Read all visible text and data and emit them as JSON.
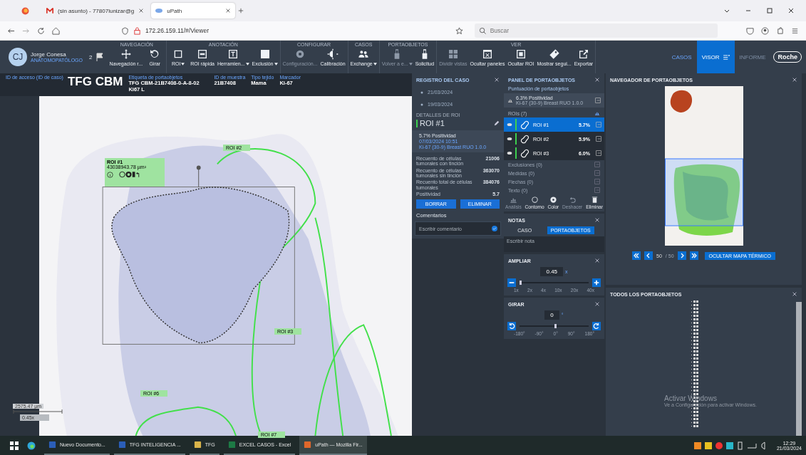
{
  "browser": {
    "tabs": [
      {
        "title": "(sin asunto) - 77807lunizar@g",
        "kind": "mail",
        "selected": false
      },
      {
        "title": "uPath",
        "kind": "app",
        "selected": true
      }
    ],
    "url": "172.26.159.11/#/Viewer",
    "search": {
      "placeholder": "Buscar"
    }
  },
  "user": {
    "initials": "CJ",
    "name": "Jorge Conesa",
    "role": "ANATOMOPATÓLOGO",
    "flag_count": "2"
  },
  "toolbar": {
    "groups": [
      {
        "title": "NAVEGACIÓN",
        "tools": [
          {
            "label": "Navegación r...",
            "kind": "move",
            "disabled": false,
            "dropdown": false
          },
          {
            "label": "Girar",
            "kind": "rotate",
            "disabled": false,
            "dropdown": false
          }
        ]
      },
      {
        "title": "ANOTACIÓN",
        "tools": [
          {
            "label": "ROI",
            "kind": "square",
            "disabled": false,
            "dropdown": true
          },
          {
            "label": "ROI rápida",
            "kind": "roi",
            "disabled": false,
            "dropdown": false
          },
          {
            "label": "Herramien...",
            "kind": "text",
            "disabled": false,
            "dropdown": true
          },
          {
            "label": "Exclusión",
            "kind": "hatch",
            "disabled": false,
            "dropdown": true
          }
        ]
      },
      {
        "title": "CONFIGURAR",
        "tools": [
          {
            "label": "Configuración...",
            "kind": "gear",
            "disabled": true,
            "dropdown": false
          },
          {
            "label": "Calibración",
            "kind": "bright",
            "disabled": false,
            "dropdown": false
          }
        ]
      },
      {
        "title": "CASOS",
        "tools": [
          {
            "label": "Exchange",
            "kind": "people",
            "disabled": false,
            "dropdown": true
          }
        ]
      },
      {
        "title": "PORTAOBJETOS",
        "tools": [
          {
            "label": "Volver a e...",
            "kind": "usb",
            "disabled": true,
            "dropdown": true
          },
          {
            "label": "Solicitud",
            "kind": "usb",
            "disabled": false,
            "dropdown": false
          }
        ]
      },
      {
        "title": "VER",
        "tools": [
          {
            "label": "Dividir vistas",
            "kind": "grid",
            "disabled": true,
            "dropdown": false
          },
          {
            "label": "Ocultar paneles",
            "kind": "xwin",
            "disabled": false,
            "dropdown": false
          },
          {
            "label": "Ocultar ROI",
            "kind": "frame",
            "disabled": false,
            "dropdown": false
          },
          {
            "label": "Mostrar segui...",
            "kind": "tag",
            "disabled": false,
            "dropdown": false
          },
          {
            "label": "Exportar",
            "kind": "export",
            "disabled": false,
            "dropdown": false
          }
        ]
      }
    ]
  },
  "nav_tabs": [
    {
      "label": "CASOS",
      "selected": false,
      "disabled": false
    },
    {
      "label": "VISOR",
      "selected": true,
      "disabled": false
    },
    {
      "label": "INFORME",
      "selected": false,
      "disabled": true
    }
  ],
  "logo": "Roche",
  "case_info": [
    {
      "label": "ID de acceso (ID de caso)",
      "value": "TFG CBM",
      "kind": "big"
    },
    {
      "label": "Etiqueta de portaobjetos",
      "value": "TFG CBM-21B7408-0-A-8-02 Ki67 L",
      "kind": "normal"
    },
    {
      "label": "ID de muestra",
      "value": "21B7408",
      "kind": "normal"
    },
    {
      "label": "Tipo tejido",
      "value": "Mama",
      "kind": "normal"
    },
    {
      "label": "Marcador",
      "value": "Ki-67",
      "kind": "normal"
    }
  ],
  "viewer": {
    "roi_card": {
      "title": "ROI #1",
      "area": "43038943.78 µm²"
    },
    "roi_labels": [
      "ROI #2",
      "ROI #3",
      "ROI #6",
      "ROI #7"
    ],
    "scale": "2575.47 µm",
    "zoom": "0.45x"
  },
  "case_log": {
    "title": "REGISTRO DEL CASO",
    "dates": [
      "21/03/2024",
      "19/03/2024"
    ]
  },
  "roi_details": {
    "heading": "DETALLES DE ROI",
    "name": "ROI #1",
    "positivity": "5.7% Positividad",
    "date": "07/03/2024 10:51",
    "algorithm": "Ki-67 (30-9) Breast RUO 1.0.0",
    "stats": [
      {
        "label": "Recuento de células tumorales con tinción",
        "value": "21006"
      },
      {
        "label": "Recuento de células tumorales sin tinción",
        "value": "363070"
      },
      {
        "label": "Recuento total de células tumorales",
        "value": "384076"
      },
      {
        "label": "Positividad",
        "value": "5.7"
      }
    ],
    "buttons": [
      "BORRAR",
      "ELIMINAR"
    ],
    "comments_title": "Comentarios",
    "comment_placeholder": "Escribir comentario"
  },
  "slide_panel": {
    "title": "PANEL DE PORTAOBJETOS",
    "score_title": "Puntuación de portaobjetos",
    "score": "6.3% Positividad",
    "algorithm": "Ki-67 (30-9) Breast RUO 1.0.0",
    "rois_title": "ROIs (7)",
    "rois": [
      {
        "name": "ROI #1",
        "value": "5.7%",
        "selected": true,
        "color": "#3ccf4e"
      },
      {
        "name": "ROI #2",
        "value": "5.9%",
        "selected": false,
        "color": "#3ccf4e"
      },
      {
        "name": "ROI #3",
        "value": "6.0%",
        "selected": false,
        "color": "#3ccf4e"
      }
    ],
    "sections": [
      "Exclusiones (0)",
      "Medidas (0)",
      "Flechas (0)",
      "Texto (0)"
    ],
    "tools": [
      {
        "label": "Análisis",
        "kind": "chart",
        "disabled": true
      },
      {
        "label": "Contorno",
        "kind": "ring",
        "disabled": false
      },
      {
        "label": "Color",
        "kind": "disc",
        "disabled": false
      },
      {
        "label": "Deshacer",
        "kind": "undo",
        "disabled": true
      },
      {
        "label": "Eliminar",
        "kind": "trash",
        "disabled": false
      }
    ]
  },
  "notes": {
    "title": "NOTAS",
    "tabs": [
      {
        "label": "CASO",
        "selected": false
      },
      {
        "label": "PORTAOBJETOS",
        "selected": true
      }
    ],
    "placeholder": "Escribir nota"
  },
  "zoom": {
    "title": "AMPLIAR",
    "value": "0.45",
    "unit": "x",
    "level": 0.0,
    "ticks": [
      "1x",
      "2x",
      "4x",
      "10x",
      "20x",
      "40x"
    ]
  },
  "rotate": {
    "title": "GIRAR",
    "value": "0",
    "unit": "°",
    "level": 0.5,
    "ticks": [
      "-180°",
      "-90°",
      "0°",
      "90°",
      "180°"
    ]
  },
  "navigator": {
    "title": "NAVEGADOR DE PORTAOBJETOS",
    "page": "50",
    "total": "/ 50",
    "heatmap_button": "OCULTAR MAPA TÉRMICO"
  },
  "all_slides": {
    "title": "TODOS LOS PORTAOBJETOS"
  },
  "os_notice": {
    "title": "Activar Windows",
    "text": "Ve a Configuración para activar Windows."
  },
  "taskbar": {
    "apps": [
      {
        "label": "Nuevo Documento...",
        "kind": "word",
        "selected": false
      },
      {
        "label": "TFG INTELIGENCIA ...",
        "kind": "word",
        "selected": false
      },
      {
        "label": "TFG",
        "kind": "file",
        "selected": false
      },
      {
        "label": "EXCEL CASOS - Excel",
        "kind": "excel",
        "selected": false
      },
      {
        "label": "uPath — Mozilla Fir...",
        "kind": "browser",
        "selected": true
      }
    ],
    "time": "12:29",
    "date": "21/03/2024"
  }
}
